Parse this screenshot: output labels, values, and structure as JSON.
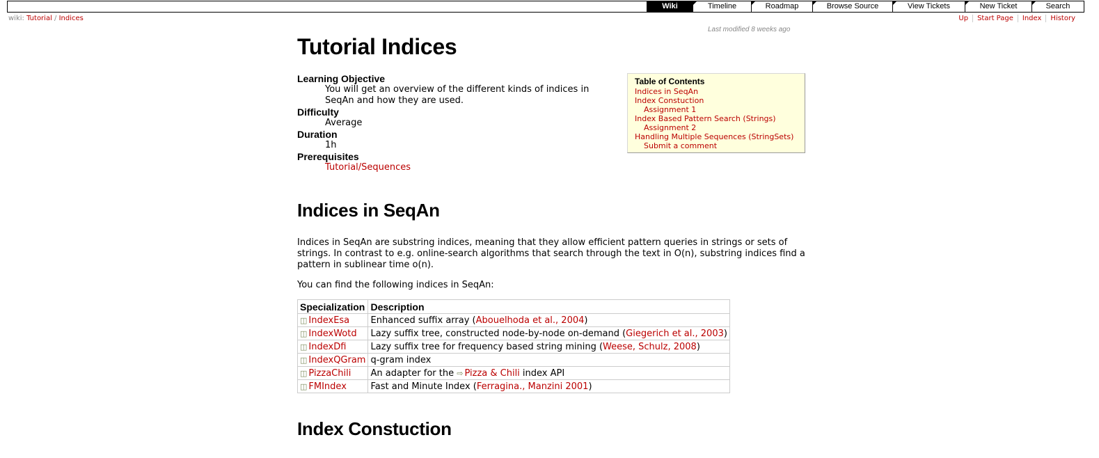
{
  "nav": {
    "items": [
      {
        "label": "Wiki",
        "active": true,
        "width": 66
      },
      {
        "label": "Timeline",
        "active": false,
        "width": 84
      },
      {
        "label": "Roadmap",
        "active": false,
        "width": 88
      },
      {
        "label": "Browse Source",
        "active": false,
        "width": 115
      },
      {
        "label": "View Tickets",
        "active": false,
        "width": 104
      },
      {
        "label": "New Ticket",
        "active": false,
        "width": 96
      },
      {
        "label": "Search",
        "active": false,
        "width": 75
      }
    ]
  },
  "breadcrumb": {
    "prefix": "wiki:",
    "part1": "Tutorial",
    "sep": "/",
    "part2": "Indices"
  },
  "context_nav": [
    "Up",
    "Start Page",
    "Index",
    "History"
  ],
  "last_modified": {
    "prefix": "Last modified",
    "ago": "8 weeks ago"
  },
  "title": "Tutorial Indices",
  "meta": {
    "objective_label": "Learning Objective",
    "objective_text": "You will get an overview of the different kinds of indices in SeqAn and how they are used.",
    "difficulty_label": "Difficulty",
    "difficulty_text": "Average",
    "duration_label": "Duration",
    "duration_text": "1h",
    "prereq_label": "Prerequisites",
    "prereq_link": "Tutorial/Sequences"
  },
  "toc": {
    "heading": "Table of Contents",
    "items": [
      {
        "label": "Indices in SeqAn",
        "sub": false
      },
      {
        "label": "Index Constuction",
        "sub": false
      },
      {
        "label": "Assignment 1",
        "sub": true
      },
      {
        "label": "Index Based Pattern Search (Strings)",
        "sub": false
      },
      {
        "label": "Assignment 2",
        "sub": true
      },
      {
        "label": "Handling Multiple Sequences (StringSets)",
        "sub": false
      },
      {
        "label": "Submit a comment",
        "sub": true
      }
    ]
  },
  "section1": {
    "heading": "Indices in SeqAn",
    "para": "Indices in SeqAn are substring indices, meaning that they allow efficient pattern queries in strings or sets of strings. In contrast to e.g. online-search algorithms that search through the text in O(n), substring indices find a pattern in sublinear time o(n).",
    "para2": "You can find the following indices in SeqAn:"
  },
  "table": {
    "headers": [
      "Specialization",
      "Description"
    ],
    "rows": [
      {
        "spec": "IndexEsa",
        "desc_pre": "Enhanced suffix array (",
        "desc_link": "Abouelhoda et al., 2004",
        "desc_post": ")",
        "ext": false
      },
      {
        "spec": "IndexWotd",
        "desc_pre": "Lazy suffix tree, constructed node-by-node on-demand (",
        "desc_link": "Giegerich et al., 2003",
        "desc_post": ")",
        "ext": false
      },
      {
        "spec": "IndexDfi",
        "desc_pre": "Lazy suffix tree for frequency based string mining (",
        "desc_link": "Weese, Schulz, 2008",
        "desc_post": ")",
        "ext": false
      },
      {
        "spec": "IndexQGram",
        "desc_pre": "q-gram index",
        "desc_link": "",
        "desc_post": "",
        "ext": false
      },
      {
        "spec": "PizzaChili",
        "desc_pre": "An adapter for the ",
        "desc_link": "Pizza & Chili",
        "desc_post": " index API",
        "ext": true
      },
      {
        "spec": "FMIndex",
        "desc_pre": "Fast and Minute Index (",
        "desc_link": "Ferragina., Manzini 2001",
        "desc_post": ")",
        "ext": false
      }
    ]
  },
  "section2": {
    "heading": "Index Constuction"
  }
}
